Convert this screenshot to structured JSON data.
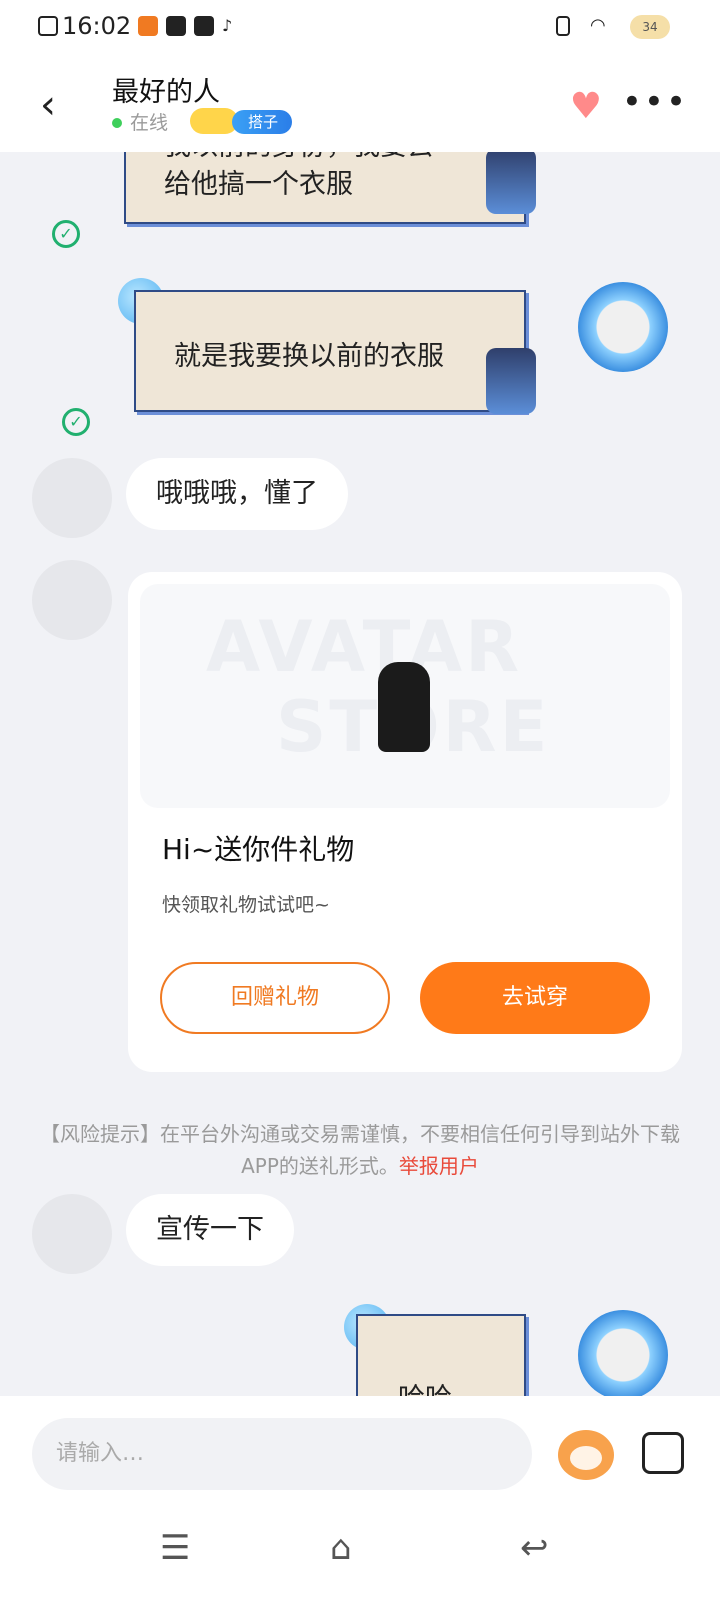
{
  "status_bar": {
    "time": "16:02",
    "battery_level": "34"
  },
  "header": {
    "title": "最好的人",
    "online_status": "在线",
    "tag": "搭子",
    "back_icon": "chevron-left-icon",
    "heart_icon": "double-heart-icon",
    "more_icon": "more-dots-icon"
  },
  "messages": [
    {
      "type": "card",
      "sender": "me",
      "text_line1": "我以前的身份，我要去",
      "text_line2": "给他搞一个衣服",
      "status": "delivered"
    },
    {
      "type": "card",
      "sender": "me",
      "text": "就是我要换以前的衣服",
      "status": "delivered"
    },
    {
      "type": "text",
      "sender": "other",
      "text": "哦哦哦，懂了"
    },
    {
      "type": "gift",
      "sender": "other",
      "title": "Hi~送你件礼物",
      "subtitle": "快领取礼物试试吧~",
      "watermark_line1": "AVATAR",
      "watermark_line2": "STORE",
      "button_return_gift": "回赠礼物",
      "button_try_on": "去试穿"
    },
    {
      "type": "notice",
      "text": "【风险提示】在平台外沟通或交易需谨慎，不要相信任何引导到站外下载APP的送礼形式。",
      "link": "举报用户"
    },
    {
      "type": "text",
      "sender": "other",
      "text": "宣传一下"
    },
    {
      "type": "card",
      "sender": "me",
      "text": "哈哈"
    }
  ],
  "input_bar": {
    "placeholder": "请输入…",
    "emoji_icon": "fox-emoji-icon",
    "image_icon": "image-icon"
  },
  "nav_bar": {
    "menu_icon": "menu-icon",
    "home_icon": "home-icon",
    "back_icon": "back-icon"
  },
  "colors": {
    "accent": "#ff7a18",
    "online": "#3ecf5b",
    "check": "#21b06f",
    "report": "#e94a3a",
    "tag": "#2b7ee8"
  }
}
